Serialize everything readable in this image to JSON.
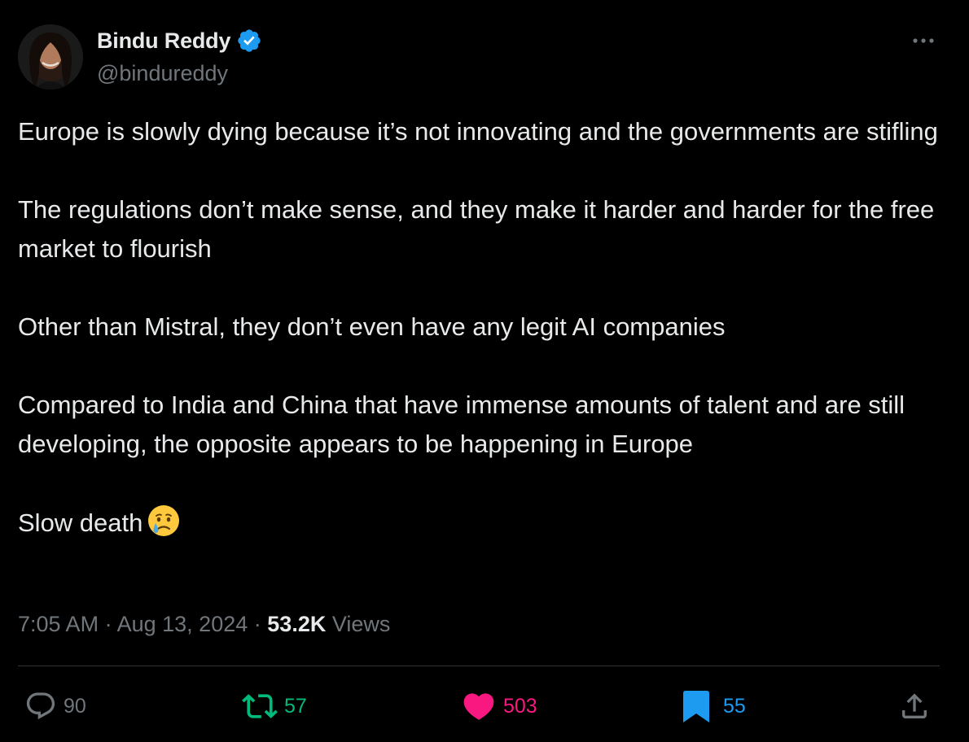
{
  "author": {
    "display_name": "Bindu Reddy",
    "handle": "@bindureddy",
    "verified": true
  },
  "tweet": {
    "paragraphs": [
      "Europe is slowly dying because it’s not innovating and the governments are stifling",
      "The regulations don’t make sense, and they make it harder and harder for the free market to flourish",
      "Other than Mistral, they don’t even have any legit AI companies",
      "Compared to India and China that have immense amounts of talent and are still developing, the opposite appears to be happening in Europe",
      "Slow death"
    ],
    "closing_emoji": "crying-face-emoji"
  },
  "meta": {
    "time": "7:05 AM",
    "separator": "·",
    "date": "Aug 13, 2024",
    "views_count": "53.2K",
    "views_label": "Views"
  },
  "actions": {
    "reply": {
      "icon": "reply-icon",
      "count": "90"
    },
    "retweet": {
      "icon": "retweet-icon",
      "count": "57"
    },
    "like": {
      "icon": "heart-icon",
      "count": "503"
    },
    "bookmark": {
      "icon": "bookmark-icon",
      "count": "55"
    },
    "share": {
      "icon": "share-icon"
    }
  },
  "colors": {
    "background": "#000000",
    "text": "#e7e9ea",
    "muted": "#71767b",
    "verified": "#1d9bf0",
    "retweet": "#00ba7c",
    "like": "#f91880",
    "bookmark": "#1d9bf0",
    "divider": "#2f3336"
  }
}
